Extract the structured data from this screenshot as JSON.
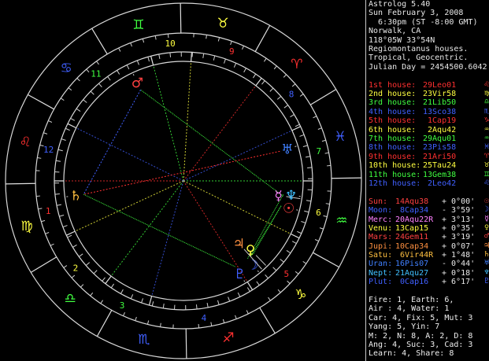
{
  "header": {
    "title": "Astrolog 5.40",
    "date_line": "Sun February 3, 2008",
    "time_line": "  6:30pm (ST -8:00 GMT)",
    "place_line": "Norwalk, CA",
    "coords_line": "118°05W 33°54N",
    "system_line": "Regiomontanus houses.",
    "zodiac_line": "Tropical, Geocentric.",
    "julian_line": "Julian Day = 2454500.6042"
  },
  "houses": [
    {
      "label": "1st house:",
      "value": "29Leo01",
      "color": "#ff3030",
      "sym": "♌"
    },
    {
      "label": "2nd house:",
      "value": "23Vir58",
      "color": "#ffff40",
      "sym": "♍"
    },
    {
      "label": "3rd house:",
      "value": "21Lib50",
      "color": "#40ff40",
      "sym": "♎"
    },
    {
      "label": "4th house:",
      "value": "13Sco38",
      "color": "#4060ff",
      "sym": "♏"
    },
    {
      "label": "5th house:",
      "value": " 1Cap19",
      "color": "#ff3030",
      "sym": "♑"
    },
    {
      "label": "6th house:",
      "value": " 2Aqu42",
      "color": "#ffff40",
      "sym": "♒"
    },
    {
      "label": "7th house:",
      "value": "29Aqu01",
      "color": "#40ff40",
      "sym": "♒"
    },
    {
      "label": "8th house:",
      "value": "23Pis58",
      "color": "#4060ff",
      "sym": "♓"
    },
    {
      "label": "9th house:",
      "value": "21Ari50",
      "color": "#ff3030",
      "sym": "♈"
    },
    {
      "label": "10th house:",
      "value": "25Tau24",
      "color": "#ffff40",
      "sym": "♉"
    },
    {
      "label": "11th house:",
      "value": "13Gem38",
      "color": "#40ff40",
      "sym": "♊"
    },
    {
      "label": "12th house:",
      "value": " 2Leo42",
      "color": "#4060ff",
      "sym": "♌"
    }
  ],
  "planets": [
    {
      "label": "Sun:",
      "value": "14Aqu38 ",
      "aspect": "+ 0°00'",
      "color": "#ff4040",
      "sym": "☉"
    },
    {
      "label": "Moon:",
      "value": " 8Cap34 ",
      "aspect": "- 3°59'",
      "color": "#4060ff",
      "sym": "☽"
    },
    {
      "label": "Merc:",
      "value": "20Aqu22R",
      "aspect": "+ 3°13'",
      "color": "#ff80ff",
      "sym": "☿"
    },
    {
      "label": "Venu:",
      "value": "13Cap15 ",
      "aspect": "+ 0°35'",
      "color": "#ffff40",
      "sym": "♀"
    },
    {
      "label": "Mars:",
      "value": "24Gem11 ",
      "aspect": "+ 3°19'",
      "color": "#ff4040",
      "sym": "♂"
    },
    {
      "label": "Jupi:",
      "value": "10Cap34 ",
      "aspect": "+ 0°07'",
      "color": "#ff9040",
      "sym": "♃"
    },
    {
      "label": "Satu:",
      "value": " 6Vir44R",
      "aspect": "+ 1°48'",
      "color": "#ffc040",
      "sym": "♄"
    },
    {
      "label": "Uran:",
      "value": "16Pis07 ",
      "aspect": "- 0°44'",
      "color": "#4080ff",
      "sym": "♅"
    },
    {
      "label": "Nept:",
      "value": "21Aqu27 ",
      "aspect": "+ 0°18'",
      "color": "#40c0ff",
      "sym": "♆"
    },
    {
      "label": "Plut:",
      "value": " 0Cap16 ",
      "aspect": "+ 6°17'",
      "color": "#4060ff",
      "sym": "♇"
    }
  ],
  "stats": [
    "Fire: 1, Earth: 6,",
    "Air : 4, Water: 1",
    "Car: 4, Fix: 5, Mut: 3",
    "Yang: 5, Yin: 7",
    "M: 2, N: 8, A: 2, D: 8",
    "Ang: 4, Suc: 3, Cad: 3",
    "Learn: 4, Share: 8"
  ],
  "wheel": {
    "signs": [
      {
        "sym": "♈",
        "color": "#ff3030"
      },
      {
        "sym": "♉",
        "color": "#ffff40"
      },
      {
        "sym": "♊",
        "color": "#40ff40"
      },
      {
        "sym": "♋",
        "color": "#4060ff"
      },
      {
        "sym": "♌",
        "color": "#ff3030"
      },
      {
        "sym": "♍",
        "color": "#ffff40"
      },
      {
        "sym": "♎",
        "color": "#40ff40"
      },
      {
        "sym": "♏",
        "color": "#4060ff"
      },
      {
        "sym": "♐",
        "color": "#ff3030"
      },
      {
        "sym": "♑",
        "color": "#ffff40"
      },
      {
        "sym": "♒",
        "color": "#40ff40"
      },
      {
        "sym": "♓",
        "color": "#4060ff"
      }
    ],
    "house_numbers": [
      "1",
      "2",
      "3",
      "4",
      "5",
      "6",
      "7",
      "8",
      "9",
      "10",
      "11",
      "12"
    ],
    "house_colors": [
      "#ff3030",
      "#ffff40",
      "#40ff40",
      "#4060ff",
      "#ff3030",
      "#ffff40",
      "#40ff40",
      "#4060ff",
      "#ff3030",
      "#ffff40",
      "#40ff40",
      "#4060ff"
    ]
  }
}
